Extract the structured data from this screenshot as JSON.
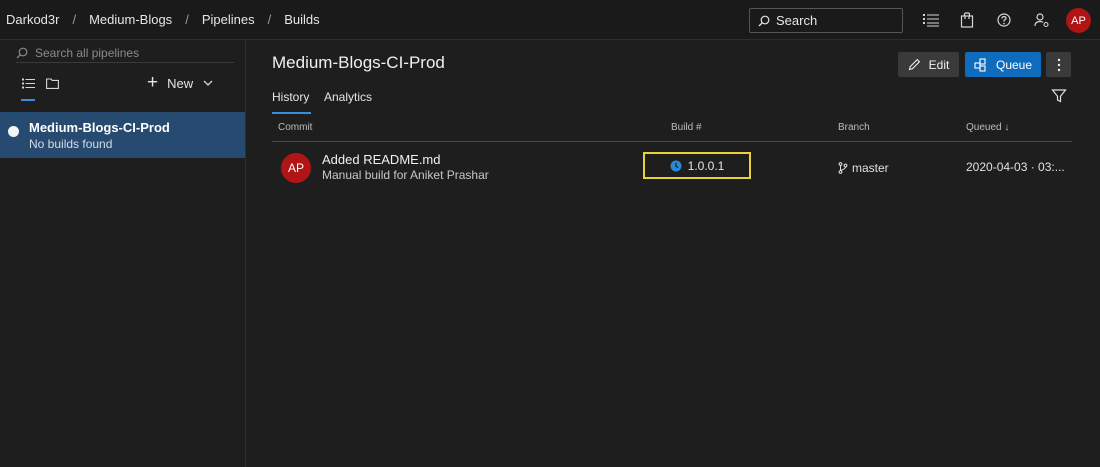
{
  "breadcrumb": {
    "org": "Darkod3r",
    "project": "Medium-Blogs",
    "section": "Pipelines",
    "page": "Builds",
    "separator": "/"
  },
  "header": {
    "search_label": "Search",
    "user_initials": "AP"
  },
  "sidebar": {
    "search_placeholder": "Search all pipelines",
    "new_label": "New",
    "items": [
      {
        "title": "Medium-Blogs-CI-Prod",
        "subtitle": "No builds found"
      }
    ]
  },
  "main": {
    "title": "Medium-Blogs-CI-Prod",
    "edit_label": "Edit",
    "queue_label": "Queue",
    "tabs": [
      {
        "label": "History",
        "active": true
      },
      {
        "label": "Analytics",
        "active": false
      }
    ],
    "columns": {
      "commit": "Commit",
      "build": "Build #",
      "branch": "Branch",
      "queued": "Queued ↓"
    },
    "rows": [
      {
        "avatar": "AP",
        "commit_title": "Added README.md",
        "commit_sub": "Manual build for Aniket Prashar",
        "build": "1.0.0.1",
        "branch": "master",
        "queued": "2020-04-03 · 03:..."
      }
    ]
  },
  "colors": {
    "accent": "#0f6cbd",
    "selection": "#264a70",
    "avatar": "#b01414",
    "highlight": "#e8d238",
    "status_running": "#2b8ad8"
  }
}
